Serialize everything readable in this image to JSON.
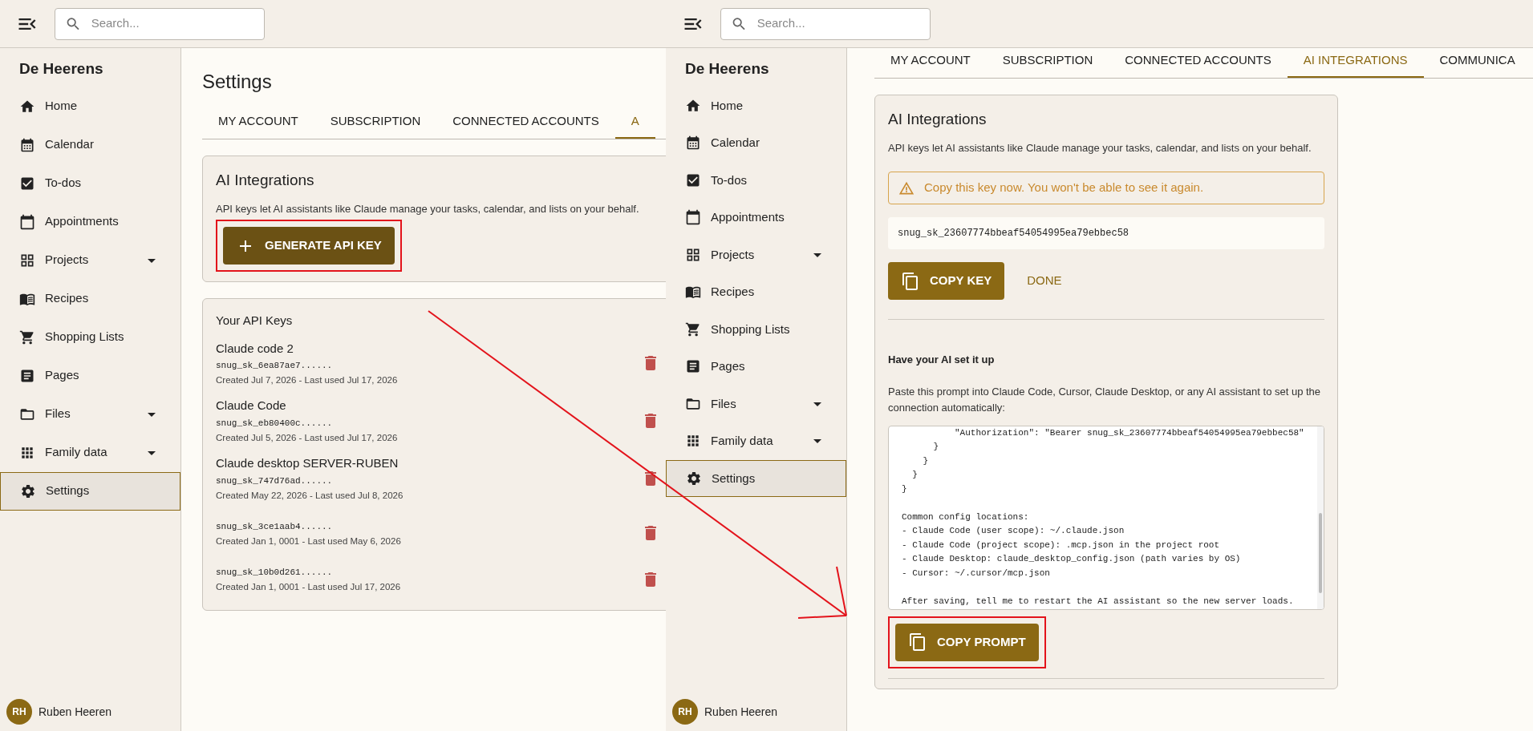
{
  "screens": [
    {
      "search": {
        "placeholder": "Search..."
      },
      "brand": "De Heerens",
      "nav": [
        {
          "label": "Home",
          "expandable": false,
          "selected": false
        },
        {
          "label": "Calendar",
          "expandable": false,
          "selected": false
        },
        {
          "label": "To-dos",
          "expandable": false,
          "selected": false
        },
        {
          "label": "Appointments",
          "expandable": false,
          "selected": false
        },
        {
          "label": "Projects",
          "expandable": true,
          "selected": false
        },
        {
          "label": "Recipes",
          "expandable": false,
          "selected": false
        },
        {
          "label": "Shopping Lists",
          "expandable": false,
          "selected": false
        },
        {
          "label": "Pages",
          "expandable": false,
          "selected": false
        },
        {
          "label": "Files",
          "expandable": true,
          "selected": false
        },
        {
          "label": "Family data",
          "expandable": true,
          "selected": false
        },
        {
          "label": "Settings",
          "expandable": false,
          "selected": true
        }
      ],
      "user": {
        "initials": "RH",
        "name": "Ruben Heeren"
      },
      "page_title": "Settings",
      "tabs": [
        {
          "label": "MY ACCOUNT",
          "selected": false
        },
        {
          "label": "SUBSCRIPTION",
          "selected": false
        },
        {
          "label": "CONNECTED ACCOUNTS",
          "selected": false
        },
        {
          "label": "A",
          "selected": true
        }
      ],
      "ai_card": {
        "title": "AI Integrations",
        "description": "API keys let AI assistants like Claude manage your tasks, calendar, and lists on your behalf.",
        "generate_button": {
          "label": "GENERATE API KEY",
          "highlighted": true
        }
      },
      "keys_card": {
        "title": "Your API Keys",
        "keys": [
          {
            "name": "Claude code 2",
            "key": "snug_sk_6ea87ae7......",
            "meta": "Created Jul 7, 2026 - Last used Jul 17, 2026"
          },
          {
            "name": "Claude Code",
            "key": "snug_sk_eb80400c......",
            "meta": "Created Jul 5, 2026 - Last used Jul 17, 2026"
          },
          {
            "name": "Claude desktop SERVER-RUBEN",
            "key": "snug_sk_747d76ad......",
            "meta": "Created May 22, 2026 - Last used Jul 8, 2026"
          },
          {
            "key": "snug_sk_3ce1aab4......",
            "meta": "Created Jan 1, 0001 - Last used May 6, 2026"
          },
          {
            "key": "snug_sk_10b0d261......",
            "meta": "Created Jan 1, 0001 - Last used Jul 17, 2026"
          }
        ]
      }
    },
    {
      "search": {
        "placeholder": "Search..."
      },
      "brand": "De Heerens",
      "nav": [
        {
          "label": "Home",
          "expandable": false,
          "selected": false
        },
        {
          "label": "Calendar",
          "expandable": false,
          "selected": false
        },
        {
          "label": "To-dos",
          "expandable": false,
          "selected": false
        },
        {
          "label": "Appointments",
          "expandable": false,
          "selected": false
        },
        {
          "label": "Projects",
          "expandable": true,
          "selected": false
        },
        {
          "label": "Recipes",
          "expandable": false,
          "selected": false
        },
        {
          "label": "Shopping Lists",
          "expandable": false,
          "selected": false
        },
        {
          "label": "Pages",
          "expandable": false,
          "selected": false
        },
        {
          "label": "Files",
          "expandable": true,
          "selected": false
        },
        {
          "label": "Family data",
          "expandable": true,
          "selected": false
        },
        {
          "label": "Settings",
          "expandable": false,
          "selected": true
        }
      ],
      "user": {
        "initials": "RH",
        "name": "Ruben Heeren"
      },
      "tabs": [
        {
          "label": "MY ACCOUNT",
          "selected": false
        },
        {
          "label": "SUBSCRIPTION",
          "selected": false
        },
        {
          "label": "CONNECTED ACCOUNTS",
          "selected": false
        },
        {
          "label": "AI INTEGRATIONS",
          "selected": true
        },
        {
          "label": "COMMUNICA",
          "selected": false
        }
      ],
      "ai_card": {
        "title": "AI Integrations",
        "description": "API keys let AI assistants like Claude manage your tasks, calendar, and lists on your behalf.",
        "warning": "Copy this key now. You won't be able to see it again.",
        "new_key": "snug_sk_23607774bbeaf54054995ea79ebbec58",
        "copy_button": {
          "label": "COPY KEY"
        },
        "done_button": "DONE",
        "setup": {
          "title": "Have your AI set it up",
          "description": "Paste this prompt into Claude Code, Cursor, Claude Desktop, or any AI assistant to set up the connection automatically:",
          "prompt": "          \"Authorization\": \"Bearer snug_sk_23607774bbeaf54054995ea79ebbec58\"\n      }\n    }\n  }\n}\n\nCommon config locations:\n- Claude Code (user scope): ~/.claude.json\n- Claude Code (project scope): .mcp.json in the project root\n- Claude Desktop: claude_desktop_config.json (path varies by OS)\n- Cursor: ~/.cursor/mcp.json\n\nAfter saving, tell me to restart the AI assistant so the new server loads.",
          "copy_button": {
            "label": "COPY PROMPT",
            "highlighted": true
          }
        }
      }
    }
  ]
}
